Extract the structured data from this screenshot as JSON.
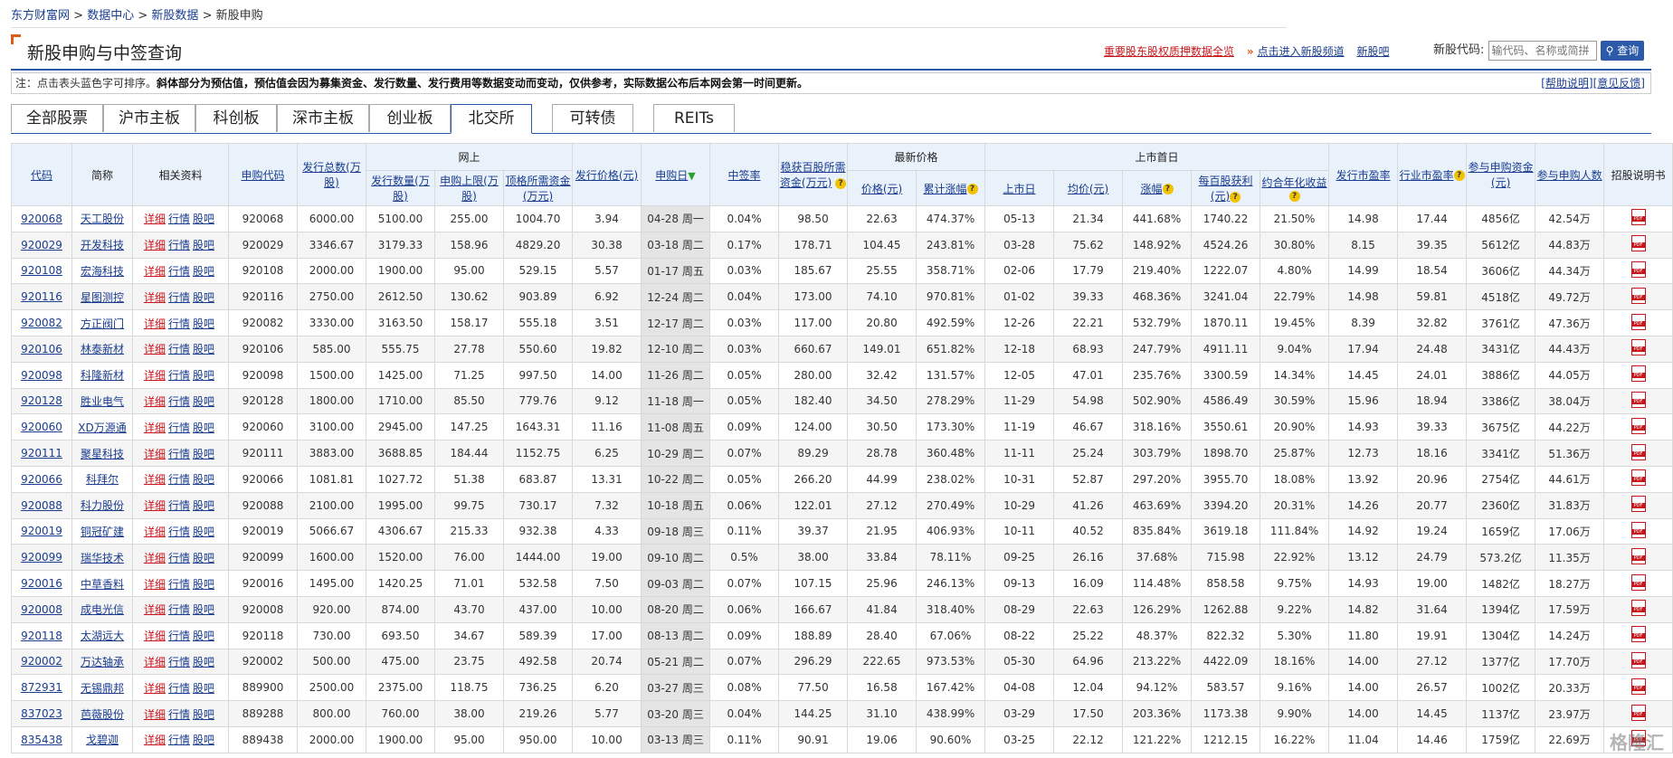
{
  "breadcrumb": [
    "东方财富网",
    "数据中心",
    "新股数据",
    "新股申购"
  ],
  "breadcrumb_sep": ">",
  "page_title": "新股申购与中签查询",
  "top_links": {
    "pledge": "重要股东股权质押数据全览",
    "enter_channel": "点击进入新股频道",
    "bar": "新股吧"
  },
  "search": {
    "label": "新股代码:",
    "placeholder": "输代码、名称或简拼",
    "button": "查询"
  },
  "note": {
    "prefix": "注：点击表头蓝色字可排序。",
    "bold": "斜体部分为预估值，预估值会因为募集资金、发行数量、发行费用等数据变动而变动，仅供参考，实际数据公布后本网会第一时间更新。",
    "help": "[帮助说明]",
    "feedback": "[意见反馈]"
  },
  "tabs": [
    "全部股票",
    "沪市主板",
    "科创板",
    "深市主板",
    "创业板",
    "北交所",
    "可转债",
    "REITs"
  ],
  "active_tab": "北交所",
  "headers": {
    "code": "代码",
    "name": "简称",
    "links": "相关资料",
    "sub_code": "申购代码",
    "total_issue": "发行总数(万股)",
    "online": "网上",
    "online_issue": "发行数量(万股)",
    "online_limit": "申购上限(万股)",
    "top_fund": "顶格所需资金(万元)",
    "price": "发行价格(元)",
    "sub_date": "申购日",
    "rate": "中签率",
    "stable_fund": "稳获百股所需资金(万元)",
    "latest": "最新价格",
    "latest_price": "价格(元)",
    "cum_gain": "累计涨幅",
    "first_day": "上市首日",
    "list_date": "上市日",
    "avg_price": "均价(元)",
    "gain": "涨幅",
    "profit": "每百股获利(元)",
    "annual": "约合年化收益",
    "issue_pe": "发行市盈率",
    "industry_pe": "行业市盈率",
    "sub_funds": "参与申购资金(元)",
    "sub_people": "参与申购人数",
    "prospectus": "招股说明书"
  },
  "row_links": [
    "详细",
    "行情",
    "股吧"
  ],
  "rows": [
    [
      "920068",
      "天工股份",
      "920068",
      "6000.00",
      "5100.00",
      "255.00",
      "1004.70",
      "3.94",
      "04-28 周一",
      "0.04%",
      "98.50",
      "22.63",
      "474.37%",
      "05-13",
      "21.34",
      "441.68%",
      "1740.22",
      "21.50%",
      "14.98",
      "17.44",
      "4856亿",
      "42.54万"
    ],
    [
      "920029",
      "开发科技",
      "920029",
      "3346.67",
      "3179.33",
      "158.96",
      "4829.20",
      "30.38",
      "03-18 周二",
      "0.17%",
      "178.71",
      "104.45",
      "243.81%",
      "03-28",
      "75.62",
      "148.92%",
      "4524.26",
      "30.80%",
      "8.15",
      "39.35",
      "5612亿",
      "44.83万"
    ],
    [
      "920108",
      "宏海科技",
      "920108",
      "2000.00",
      "1900.00",
      "95.00",
      "529.15",
      "5.57",
      "01-17 周五",
      "0.03%",
      "185.67",
      "25.55",
      "358.71%",
      "02-06",
      "17.79",
      "219.40%",
      "1222.07",
      "4.80%",
      "14.99",
      "18.54",
      "3606亿",
      "44.34万"
    ],
    [
      "920116",
      "星图测控",
      "920116",
      "2750.00",
      "2612.50",
      "130.62",
      "903.89",
      "6.92",
      "12-24 周二",
      "0.04%",
      "173.00",
      "74.10",
      "970.81%",
      "01-02",
      "39.33",
      "468.36%",
      "3241.04",
      "22.79%",
      "14.98",
      "59.81",
      "4518亿",
      "49.72万"
    ],
    [
      "920082",
      "方正阀门",
      "920082",
      "3330.00",
      "3163.50",
      "158.17",
      "555.18",
      "3.51",
      "12-17 周二",
      "0.03%",
      "117.00",
      "20.80",
      "492.59%",
      "12-26",
      "22.21",
      "532.79%",
      "1870.11",
      "19.45%",
      "8.39",
      "32.82",
      "3761亿",
      "47.36万"
    ],
    [
      "920106",
      "林泰新材",
      "920106",
      "585.00",
      "555.75",
      "27.78",
      "550.60",
      "19.82",
      "12-10 周二",
      "0.03%",
      "660.67",
      "149.01",
      "651.82%",
      "12-18",
      "68.93",
      "247.79%",
      "4911.11",
      "9.04%",
      "17.94",
      "24.48",
      "3431亿",
      "44.43万"
    ],
    [
      "920098",
      "科隆新材",
      "920098",
      "1500.00",
      "1425.00",
      "71.25",
      "997.50",
      "14.00",
      "11-26 周二",
      "0.05%",
      "280.00",
      "32.42",
      "131.57%",
      "12-05",
      "47.01",
      "235.76%",
      "3300.59",
      "14.34%",
      "14.45",
      "24.01",
      "3886亿",
      "44.05万"
    ],
    [
      "920128",
      "胜业电气",
      "920128",
      "1800.00",
      "1710.00",
      "85.50",
      "779.76",
      "9.12",
      "11-18 周一",
      "0.05%",
      "182.40",
      "34.50",
      "278.29%",
      "11-29",
      "54.98",
      "502.90%",
      "4586.49",
      "30.59%",
      "15.96",
      "18.94",
      "3386亿",
      "38.04万"
    ],
    [
      "920060",
      "XD万源通",
      "920060",
      "3100.00",
      "2945.00",
      "147.25",
      "1643.31",
      "11.16",
      "11-08 周五",
      "0.09%",
      "124.00",
      "30.50",
      "173.30%",
      "11-19",
      "46.67",
      "318.16%",
      "3550.61",
      "20.90%",
      "14.93",
      "39.33",
      "3675亿",
      "44.22万"
    ],
    [
      "920111",
      "聚星科技",
      "920111",
      "3883.00",
      "3688.85",
      "184.44",
      "1152.75",
      "6.25",
      "10-29 周二",
      "0.07%",
      "89.29",
      "28.78",
      "360.48%",
      "11-11",
      "25.24",
      "303.79%",
      "1898.70",
      "25.87%",
      "12.73",
      "18.16",
      "3341亿",
      "51.36万"
    ],
    [
      "920066",
      "科拜尔",
      "920066",
      "1081.81",
      "1027.72",
      "51.38",
      "683.87",
      "13.31",
      "10-22 周二",
      "0.05%",
      "266.20",
      "44.99",
      "238.02%",
      "10-31",
      "52.87",
      "297.20%",
      "3955.70",
      "18.08%",
      "13.92",
      "20.96",
      "2754亿",
      "44.61万"
    ],
    [
      "920088",
      "科力股份",
      "920088",
      "2100.00",
      "1995.00",
      "99.75",
      "730.17",
      "7.32",
      "10-18 周五",
      "0.06%",
      "122.01",
      "27.12",
      "270.49%",
      "10-29",
      "41.26",
      "463.69%",
      "3394.20",
      "20.31%",
      "14.26",
      "20.77",
      "2360亿",
      "31.83万"
    ],
    [
      "920019",
      "铜冠矿建",
      "920019",
      "5066.67",
      "4306.67",
      "215.33",
      "932.38",
      "4.33",
      "09-18 周三",
      "0.11%",
      "39.37",
      "21.95",
      "406.93%",
      "10-11",
      "40.52",
      "835.84%",
      "3619.18",
      "111.84%",
      "14.92",
      "19.24",
      "1659亿",
      "17.06万"
    ],
    [
      "920099",
      "瑞华技术",
      "920099",
      "1600.00",
      "1520.00",
      "76.00",
      "1444.00",
      "19.00",
      "09-10 周二",
      "0.5%",
      "38.00",
      "33.84",
      "78.11%",
      "09-25",
      "26.16",
      "37.68%",
      "715.98",
      "22.92%",
      "13.12",
      "24.79",
      "573.2亿",
      "11.35万"
    ],
    [
      "920016",
      "中草香料",
      "920016",
      "1495.00",
      "1420.25",
      "71.01",
      "532.58",
      "7.50",
      "09-03 周二",
      "0.07%",
      "107.15",
      "25.96",
      "246.13%",
      "09-13",
      "16.09",
      "114.48%",
      "858.58",
      "9.75%",
      "14.93",
      "19.00",
      "1482亿",
      "18.27万"
    ],
    [
      "920008",
      "成电光信",
      "920008",
      "920.00",
      "874.00",
      "43.70",
      "437.00",
      "10.00",
      "08-20 周二",
      "0.06%",
      "166.67",
      "41.84",
      "318.40%",
      "08-29",
      "22.63",
      "126.29%",
      "1262.88",
      "9.22%",
      "14.82",
      "31.64",
      "1394亿",
      "17.59万"
    ],
    [
      "920118",
      "太湖远大",
      "920118",
      "730.00",
      "693.50",
      "34.67",
      "589.39",
      "17.00",
      "08-13 周二",
      "0.09%",
      "188.89",
      "28.40",
      "67.06%",
      "08-22",
      "25.22",
      "48.37%",
      "822.32",
      "5.30%",
      "11.80",
      "19.91",
      "1304亿",
      "14.24万"
    ],
    [
      "920002",
      "万达轴承",
      "920002",
      "500.00",
      "475.00",
      "23.75",
      "492.58",
      "20.74",
      "05-21 周二",
      "0.07%",
      "296.29",
      "222.65",
      "973.53%",
      "05-30",
      "64.96",
      "213.22%",
      "4422.09",
      "18.16%",
      "14.00",
      "27.12",
      "1377亿",
      "17.70万"
    ],
    [
      "872931",
      "无锡鼎邦",
      "889900",
      "2500.00",
      "2375.00",
      "118.75",
      "736.25",
      "6.20",
      "03-27 周三",
      "0.08%",
      "77.50",
      "16.58",
      "167.42%",
      "04-08",
      "12.04",
      "94.12%",
      "583.57",
      "9.16%",
      "14.00",
      "26.57",
      "1002亿",
      "20.33万"
    ],
    [
      "837023",
      "芭薇股份",
      "889288",
      "800.00",
      "760.00",
      "38.00",
      "219.26",
      "5.77",
      "03-20 周三",
      "0.04%",
      "144.25",
      "31.10",
      "438.99%",
      "03-29",
      "17.50",
      "203.36%",
      "1173.38",
      "9.90%",
      "14.00",
      "14.45",
      "1137亿",
      "23.97万"
    ],
    [
      "835438",
      "戈碧迦",
      "889438",
      "2000.00",
      "1900.00",
      "95.00",
      "950.00",
      "10.00",
      "03-13 周三",
      "0.11%",
      "90.91",
      "19.06",
      "90.60%",
      "03-25",
      "22.12",
      "121.22%",
      "1212.15",
      "16.22%",
      "11.04",
      "14.46",
      "1759亿",
      "22.69万"
    ]
  ],
  "watermark": "格隆汇"
}
